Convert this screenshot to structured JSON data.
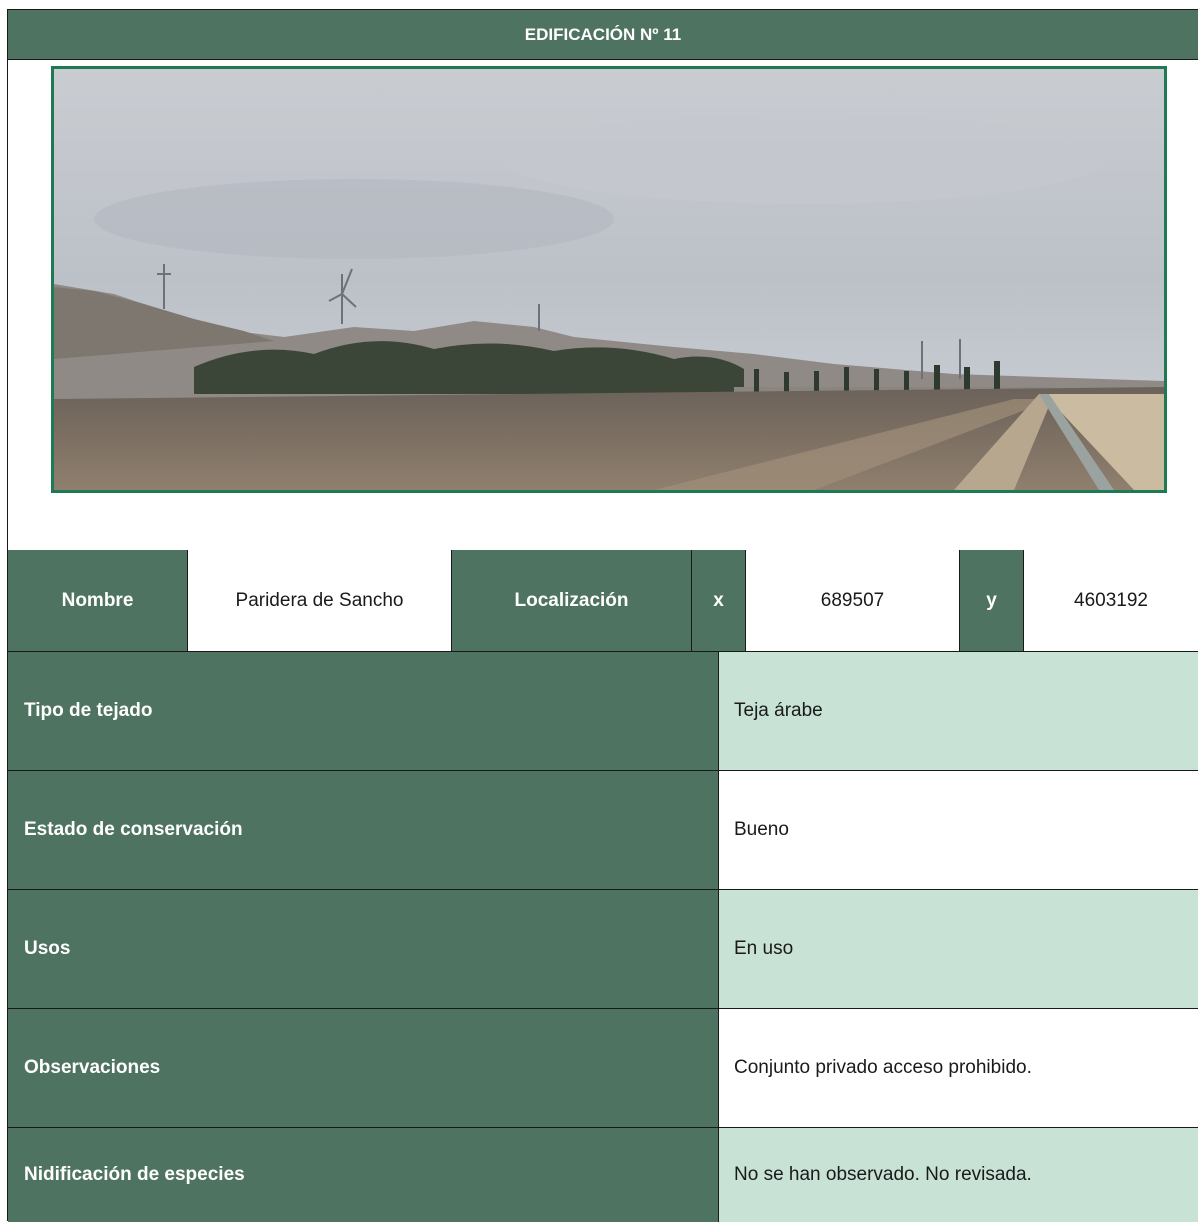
{
  "header": {
    "title": "EDIFICACIÓN Nº 11"
  },
  "photo": {
    "icon": "landscape-photo"
  },
  "identification": {
    "name_label": "Nombre",
    "name_value": "Paridera de Sancho",
    "location_label": "Localización",
    "x_label": "x",
    "x_value": "689507",
    "y_label": "y",
    "y_value": "4603192"
  },
  "fields": [
    {
      "label": "Tipo de tejado",
      "value": "Teja árabe"
    },
    {
      "label": "Estado de conservación",
      "value": "Bueno"
    },
    {
      "label": "Usos",
      "value": "En uso"
    },
    {
      "label": "Observaciones",
      "value": "Conjunto privado acceso prohibido."
    },
    {
      "label": "Nidificación de especies",
      "value": "No se han observado. No revisada."
    }
  ],
  "colors": {
    "header_green": "#4e7360",
    "value_light": "#c8e2d5",
    "frame_green": "#1e7a52"
  }
}
